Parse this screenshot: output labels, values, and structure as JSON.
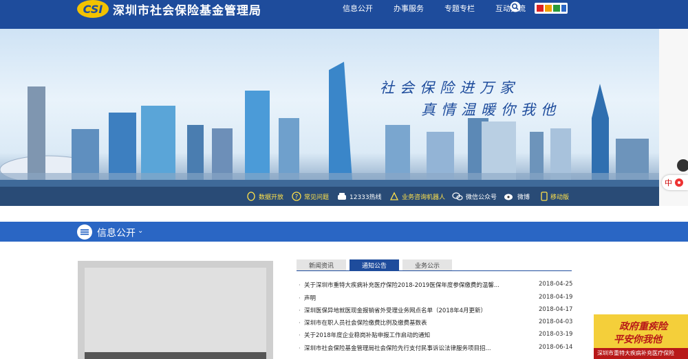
{
  "header": {
    "logo_mark": "CSI",
    "title": "深圳市社会保险基金管理局",
    "nav": [
      "信息公开",
      "办事服务",
      "专题专栏",
      "互动交流"
    ]
  },
  "banner": {
    "slogan_1": "社会保险进万家",
    "slogan_2": "真情温暖你我他"
  },
  "quick_links": [
    "数据开放",
    "常见问题",
    "12333热线",
    "业务咨询机器人",
    "微信公众号",
    "微博",
    "移动版"
  ],
  "side_float": {
    "label": "中"
  },
  "section": {
    "title": "信息公开"
  },
  "tabs": [
    {
      "label": "新闻资讯",
      "active": false
    },
    {
      "label": "通知公告",
      "active": true
    },
    {
      "label": "业务公示",
      "active": false
    }
  ],
  "news": [
    {
      "title": "关于深圳市重特大疾病补充医疗保险2018-2019医保年度参保缴费的温馨...",
      "date": "2018-04-25"
    },
    {
      "title": "声明",
      "date": "2018-04-19"
    },
    {
      "title": "深圳医保异地就医现金报销省外受理业务网点名单（2018年4月更新）",
      "date": "2018-04-17"
    },
    {
      "title": "深圳市在职人员社会保险缴费比例及缴费基数表",
      "date": "2018-04-03"
    },
    {
      "title": "关于2018年度企业稳岗补贴申报工作启动的通知",
      "date": "2018-03-19"
    },
    {
      "title": "深圳市社会保险基金管理局社会保险先行支付民事诉讼法律服务项目招...",
      "date": "2018-06-14"
    }
  ],
  "ad": {
    "line1": "政府重疾险",
    "line2": "平安你我他",
    "line3": "深圳市重特大疾病补充医疗保险"
  },
  "colors": {
    "brand_blue": "#1e4c9c",
    "section_blue": "#2a66c4",
    "quick_yellow": "#ffe14a",
    "ad_yellow": "#f4cf3a",
    "ad_red": "#b81818"
  }
}
